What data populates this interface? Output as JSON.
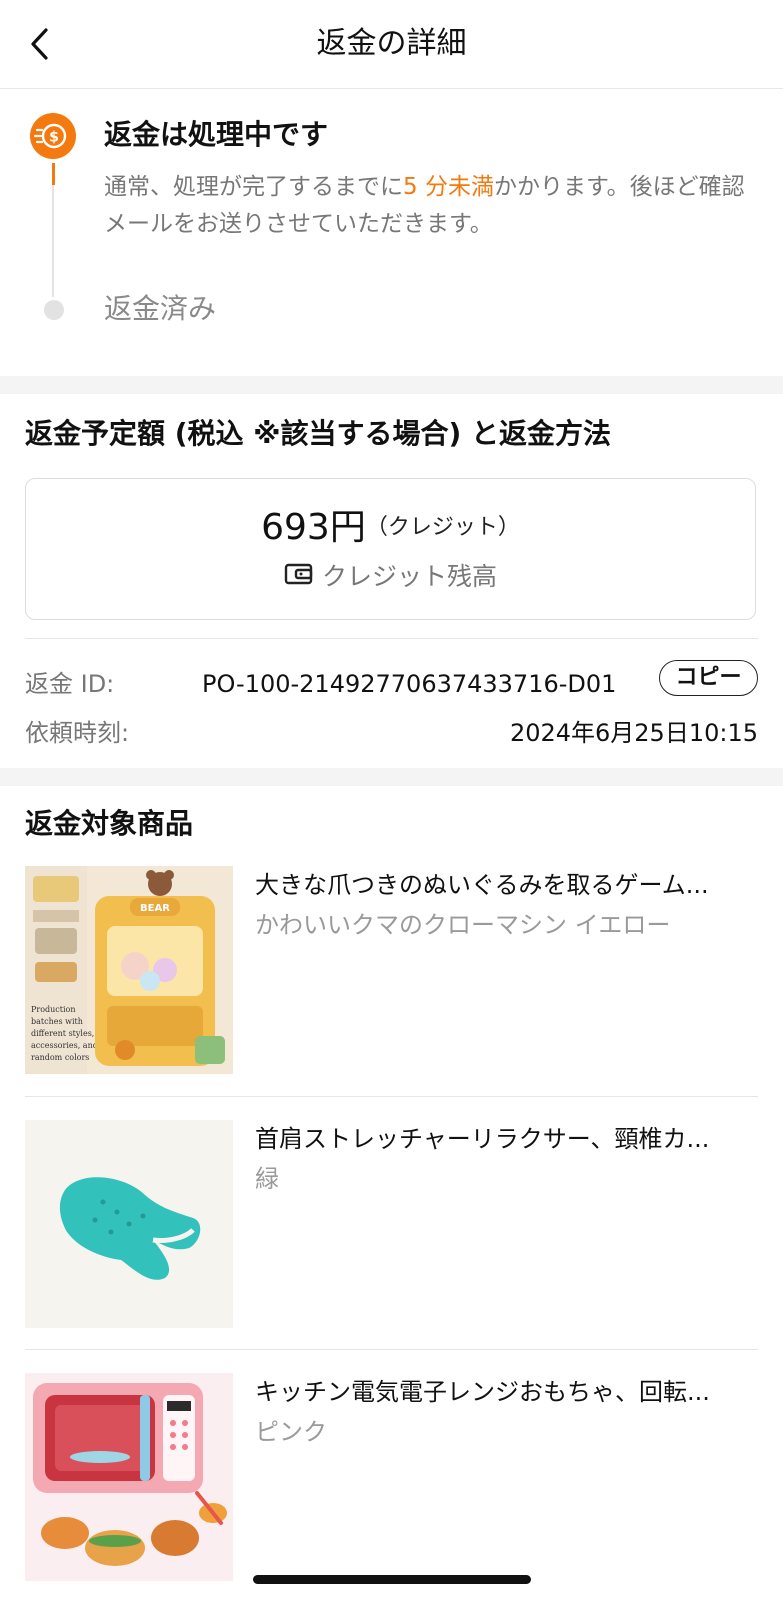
{
  "header": {
    "title": "返金の詳細"
  },
  "status": {
    "title": "返金は処理中です",
    "desc_before": "通常、処理が完了するまでに",
    "desc_highlight": "5 分未満",
    "desc_after": "かかります。後ほど確認メールをお送りさせていただきます。",
    "next_step": "返金済み",
    "accent_color": "#f47a0f"
  },
  "amount": {
    "section_title": "返金予定額 (税込 ※該当する場合) と返金方法",
    "value": "693円",
    "note": "（クレジット）",
    "method": "クレジット残高",
    "method_icon": "wallet-icon"
  },
  "refund_info": {
    "id_label": "返金 ID:",
    "id_value": "PO-100-21492770637433716-D01",
    "copy_label": "コピー",
    "time_label": "依頼時刻:",
    "time_value": "2024年6月25日10:15"
  },
  "items": {
    "section_title": "返金対象商品",
    "list": [
      {
        "name": "大きな爪つきのぬいぐるみを取るゲーム...",
        "variant": "かわいいクマのクローマシン イエロー"
      },
      {
        "name": "首肩ストレッチャーリラクサー、頸椎カ...",
        "variant": "緑"
      },
      {
        "name": "キッチン電気電子レンジおもちゃ、回転...",
        "variant": "ピンク"
      }
    ]
  }
}
